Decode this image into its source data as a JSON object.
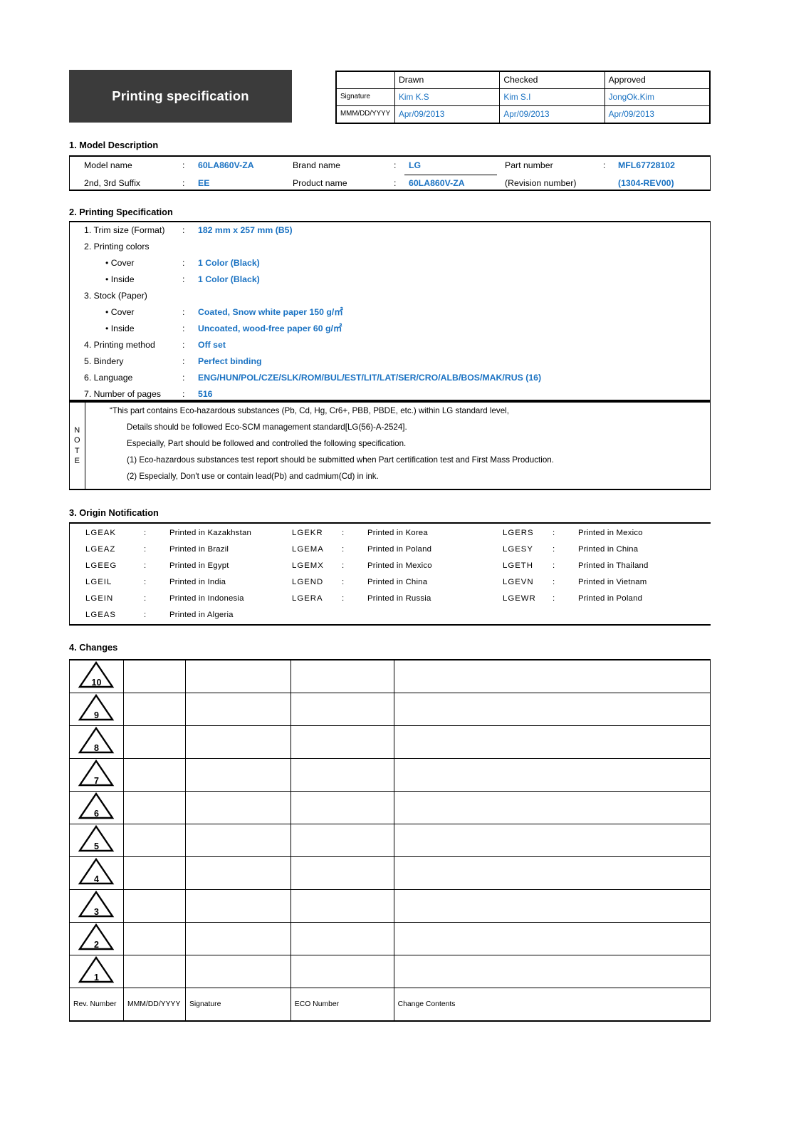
{
  "document": {
    "title": "Printing specification"
  },
  "approval": {
    "row_labels": [
      "",
      "Signature",
      "MMM/DD/YYYY"
    ],
    "columns": [
      "Drawn",
      "Checked",
      "Approved"
    ],
    "signature": [
      "Kim K.S",
      "Kim S.I",
      "JongOk.Kim"
    ],
    "date": [
      "Apr/09/2013",
      "Apr/09/2013",
      "Apr/09/2013"
    ]
  },
  "sections": {
    "model": "1. Model Description",
    "spec": "2. Printing Specification",
    "origin": "3. Origin Notification",
    "changes": "4. Changes"
  },
  "model_description": {
    "colon": ":",
    "model_name_label": "Model name",
    "model_name_value": "60LA860V-ZA",
    "suffix_label": "2nd, 3rd Suffix",
    "suffix_value": "EE",
    "brand_name_label": "Brand name",
    "brand_name_value": "LG",
    "product_name_label": "Product name",
    "product_name_value": "60LA860V-ZA",
    "part_number_label": "Part number",
    "part_number_value": "MFL67728102",
    "revision_number_label": "(Revision number)",
    "revision_number_value": "(1304-REV00)"
  },
  "printing_specification": {
    "colon": ":",
    "items": [
      {
        "label": "1. Trim size (Format)",
        "value": "182 mm x 257 mm (B5)",
        "indent": 0
      },
      {
        "label": "2. Printing colors",
        "value": "",
        "indent": 0
      },
      {
        "label": "• Cover",
        "value": "1 Color (Black)",
        "indent": 1
      },
      {
        "label": "• Inside",
        "value": "1 Color (Black)",
        "indent": 1
      },
      {
        "label": "3. Stock (Paper)",
        "value": "",
        "indent": 0
      },
      {
        "label": "• Cover",
        "value": "Coated, Snow white paper 150 g/㎡",
        "indent": 1
      },
      {
        "label": "• Inside",
        "value": "Uncoated, wood-free paper 60 g/㎡",
        "indent": 1
      },
      {
        "label": "4. Printing method",
        "value": "Off set",
        "indent": 0
      },
      {
        "label": "5. Bindery",
        "value": "Perfect binding",
        "indent": 0
      },
      {
        "label": "6. Language",
        "value": "ENG/HUN/POL/CZE/SLK/ROM/BUL/EST/LIT/LAT/SER/CRO/ALB/BOS/MAK/RUS (16)",
        "indent": 0
      },
      {
        "label": "7. Number of pages",
        "value": "516",
        "indent": 0
      }
    ]
  },
  "note": {
    "vertical_label": [
      "N",
      "O",
      "T",
      "E"
    ],
    "lines": [
      {
        "text": "“This part contains Eco-hazardous substances (Pb, Cd, Hg, Cr6+, PBB, PBDE, etc.) within LG standard level,",
        "indent": 0
      },
      {
        "text": "Details should be followed Eco-SCM management standard[LG(56)-A-2524].",
        "indent": 1
      },
      {
        "text": "Especially, Part should be followed and controlled the following specification.",
        "indent": 1
      },
      {
        "text": "(1) Eco-hazardous substances test report should be submitted when Part certification test and First Mass Production.",
        "indent": 1
      },
      {
        "text": "(2) Especially, Don't use or contain lead(Pb) and cadmium(Cd) in ink.",
        "indent": 1
      }
    ]
  },
  "origin_notification": {
    "colon": ":",
    "column1": [
      {
        "code": "LGEAK",
        "origin": "Printed in Kazakhstan"
      },
      {
        "code": "LGEAZ",
        "origin": "Printed in Brazil"
      },
      {
        "code": "LGEEG",
        "origin": "Printed in Egypt"
      },
      {
        "code": "LGEIL",
        "origin": "Printed in India"
      },
      {
        "code": "LGEIN",
        "origin": "Printed in Indonesia"
      },
      {
        "code": "LGEAS",
        "origin": "Printed in Algeria"
      }
    ],
    "column2": [
      {
        "code": "LGEKR",
        "origin": "Printed in Korea"
      },
      {
        "code": "LGEMA",
        "origin": "Printed in Poland"
      },
      {
        "code": "LGEMX",
        "origin": "Printed in Mexico"
      },
      {
        "code": "LGEND",
        "origin": "Printed in China"
      },
      {
        "code": "LGERA",
        "origin": "Printed in Russia"
      }
    ],
    "column3": [
      {
        "code": "LGERS",
        "origin": "Printed in Mexico"
      },
      {
        "code": "LGESY",
        "origin": "Printed in China"
      },
      {
        "code": "LGETH",
        "origin": "Printed in Thailand"
      },
      {
        "code": "LGEVN",
        "origin": "Printed in Vietnam"
      },
      {
        "code": "LGEWR",
        "origin": "Printed in Poland"
      }
    ]
  },
  "changes": {
    "revision_numbers": [
      "10",
      "9",
      "8",
      "7",
      "6",
      "5",
      "4",
      "3",
      "2",
      "1"
    ],
    "footer": [
      "Rev. Number",
      "MMM/DD/YYYY",
      "Signature",
      "ECO Number",
      "Change Contents"
    ],
    "rows": [
      {
        "date": "",
        "signature": "",
        "eco": "",
        "contents": ""
      },
      {
        "date": "",
        "signature": "",
        "eco": "",
        "contents": ""
      },
      {
        "date": "",
        "signature": "",
        "eco": "",
        "contents": ""
      },
      {
        "date": "",
        "signature": "",
        "eco": "",
        "contents": ""
      },
      {
        "date": "",
        "signature": "",
        "eco": "",
        "contents": ""
      },
      {
        "date": "",
        "signature": "",
        "eco": "",
        "contents": ""
      },
      {
        "date": "",
        "signature": "",
        "eco": "",
        "contents": ""
      },
      {
        "date": "",
        "signature": "",
        "eco": "",
        "contents": ""
      },
      {
        "date": "",
        "signature": "",
        "eco": "",
        "contents": ""
      },
      {
        "date": "",
        "signature": "",
        "eco": "",
        "contents": ""
      }
    ]
  },
  "colors": {
    "accent_blue": "#1a72c2",
    "title_block": "#3b3b3b",
    "rule": "#000000"
  }
}
